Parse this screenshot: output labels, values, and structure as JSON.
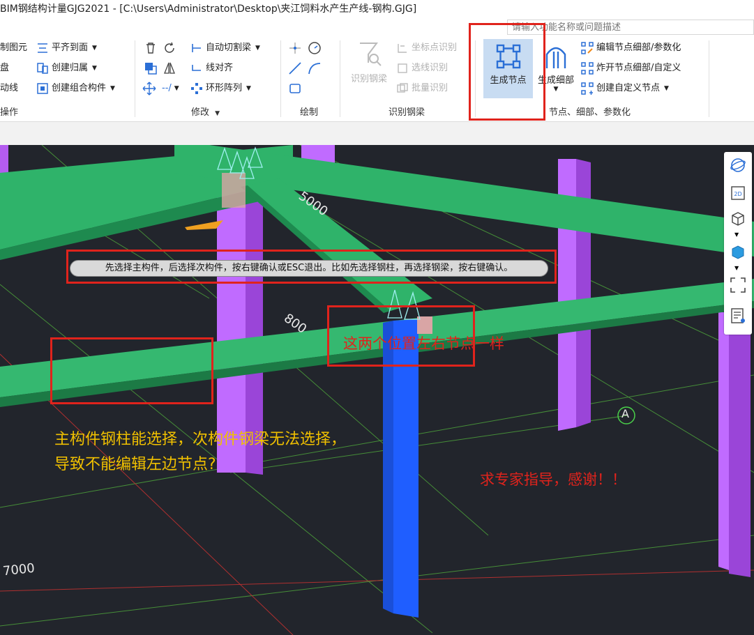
{
  "window": {
    "title": "BIM钢结构计量GJG2021 - [C:\\Users\\Administrator\\Desktop\\夹江饲料水产生产线-钢构.GJG]"
  },
  "search": {
    "placeholder": "请输入功能名称或问题描述"
  },
  "ribbon": {
    "groups": {
      "operate": {
        "label": "操作",
        "items": [
          "制图元",
          "盘",
          "动线",
          "平齐到面",
          "创建归属",
          "创建组合构件"
        ]
      },
      "modify": {
        "label": "修改",
        "items": [
          "自动切割梁",
          "线对齐",
          "环形阵列"
        ]
      },
      "draw": {
        "label": "绘制"
      },
      "recognize": {
        "label": "识别钢梁",
        "items": [
          "识别钢梁",
          "坐标点识别",
          "选线识别",
          "批量识别"
        ]
      },
      "nodes": {
        "label": "节点、细部、参数化",
        "items": [
          "生成节点",
          "生成细部",
          "编辑节点细部/参数化",
          "炸开节点细部/自定义",
          "创建自定义节点"
        ]
      }
    }
  },
  "viewport": {
    "tooltip": "先选择主构件，后选择次构件，按右键确认或ESC退出。比如先选择钢柱，再选择钢梁，按右键确认。",
    "dimensions": [
      "5000",
      "800",
      "7000"
    ],
    "axis_label": "A",
    "annotations": {
      "same_nodes": "这两个位置左右节点一样",
      "question_line1": "主构件钢柱能选择，次构件钢梁无法选择，",
      "question_line2": "导致不能编辑左边节点?",
      "plea": "求专家指导，感谢！！"
    }
  },
  "colors": {
    "beam_green": "#2fb36a",
    "column_purple": "#c06bff",
    "column_blue": "#1f5eff",
    "viewport_bg": "#22252c",
    "annotation_red": "#e0231c",
    "annotation_yellow": "#f0c000"
  }
}
